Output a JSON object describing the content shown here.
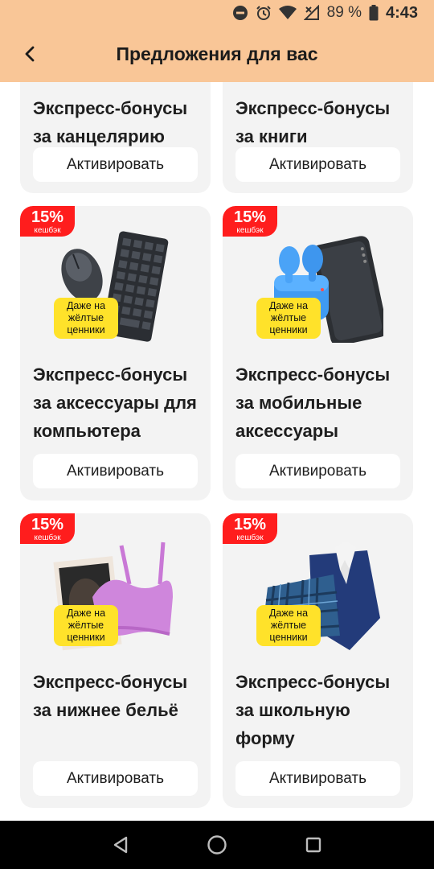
{
  "status": {
    "battery": "89 %",
    "time": "4:43"
  },
  "header": {
    "title": "Предложения для вас"
  },
  "cards": [
    {
      "title": "Экспресс-бонусы за канцелярию",
      "button": "Активировать"
    },
    {
      "title": "Экспресс-бонусы за книги",
      "button": "Активировать"
    },
    {
      "title": "Экспресс-бонусы за аксессуары для компьютера",
      "button": "Активировать",
      "cashback": "15%",
      "cashback_label": "кешбэк",
      "tag": "Даже на жёлтые ценники"
    },
    {
      "title": "Экспресс-бонусы за мобильные аксессуары",
      "button": "Активировать",
      "cashback": "15%",
      "cashback_label": "кешбэк",
      "tag": "Даже на жёлтые ценники"
    },
    {
      "title": "Экспресс-бонусы за нижнее бельё",
      "button": "Активировать",
      "cashback": "15%",
      "cashback_label": "кешбэк",
      "tag": "Даже на жёлтые ценники"
    },
    {
      "title": "Экспресс-бонусы за школьную форму",
      "button": "Активировать",
      "cashback": "15%",
      "cashback_label": "кешбэк",
      "tag": "Даже на жёлтые ценники"
    }
  ],
  "colors": {
    "header_bg": "#f9c697",
    "cashback": "#ff1d1d",
    "tag": "#ffe22a",
    "card_bg": "#f3f3f3"
  }
}
